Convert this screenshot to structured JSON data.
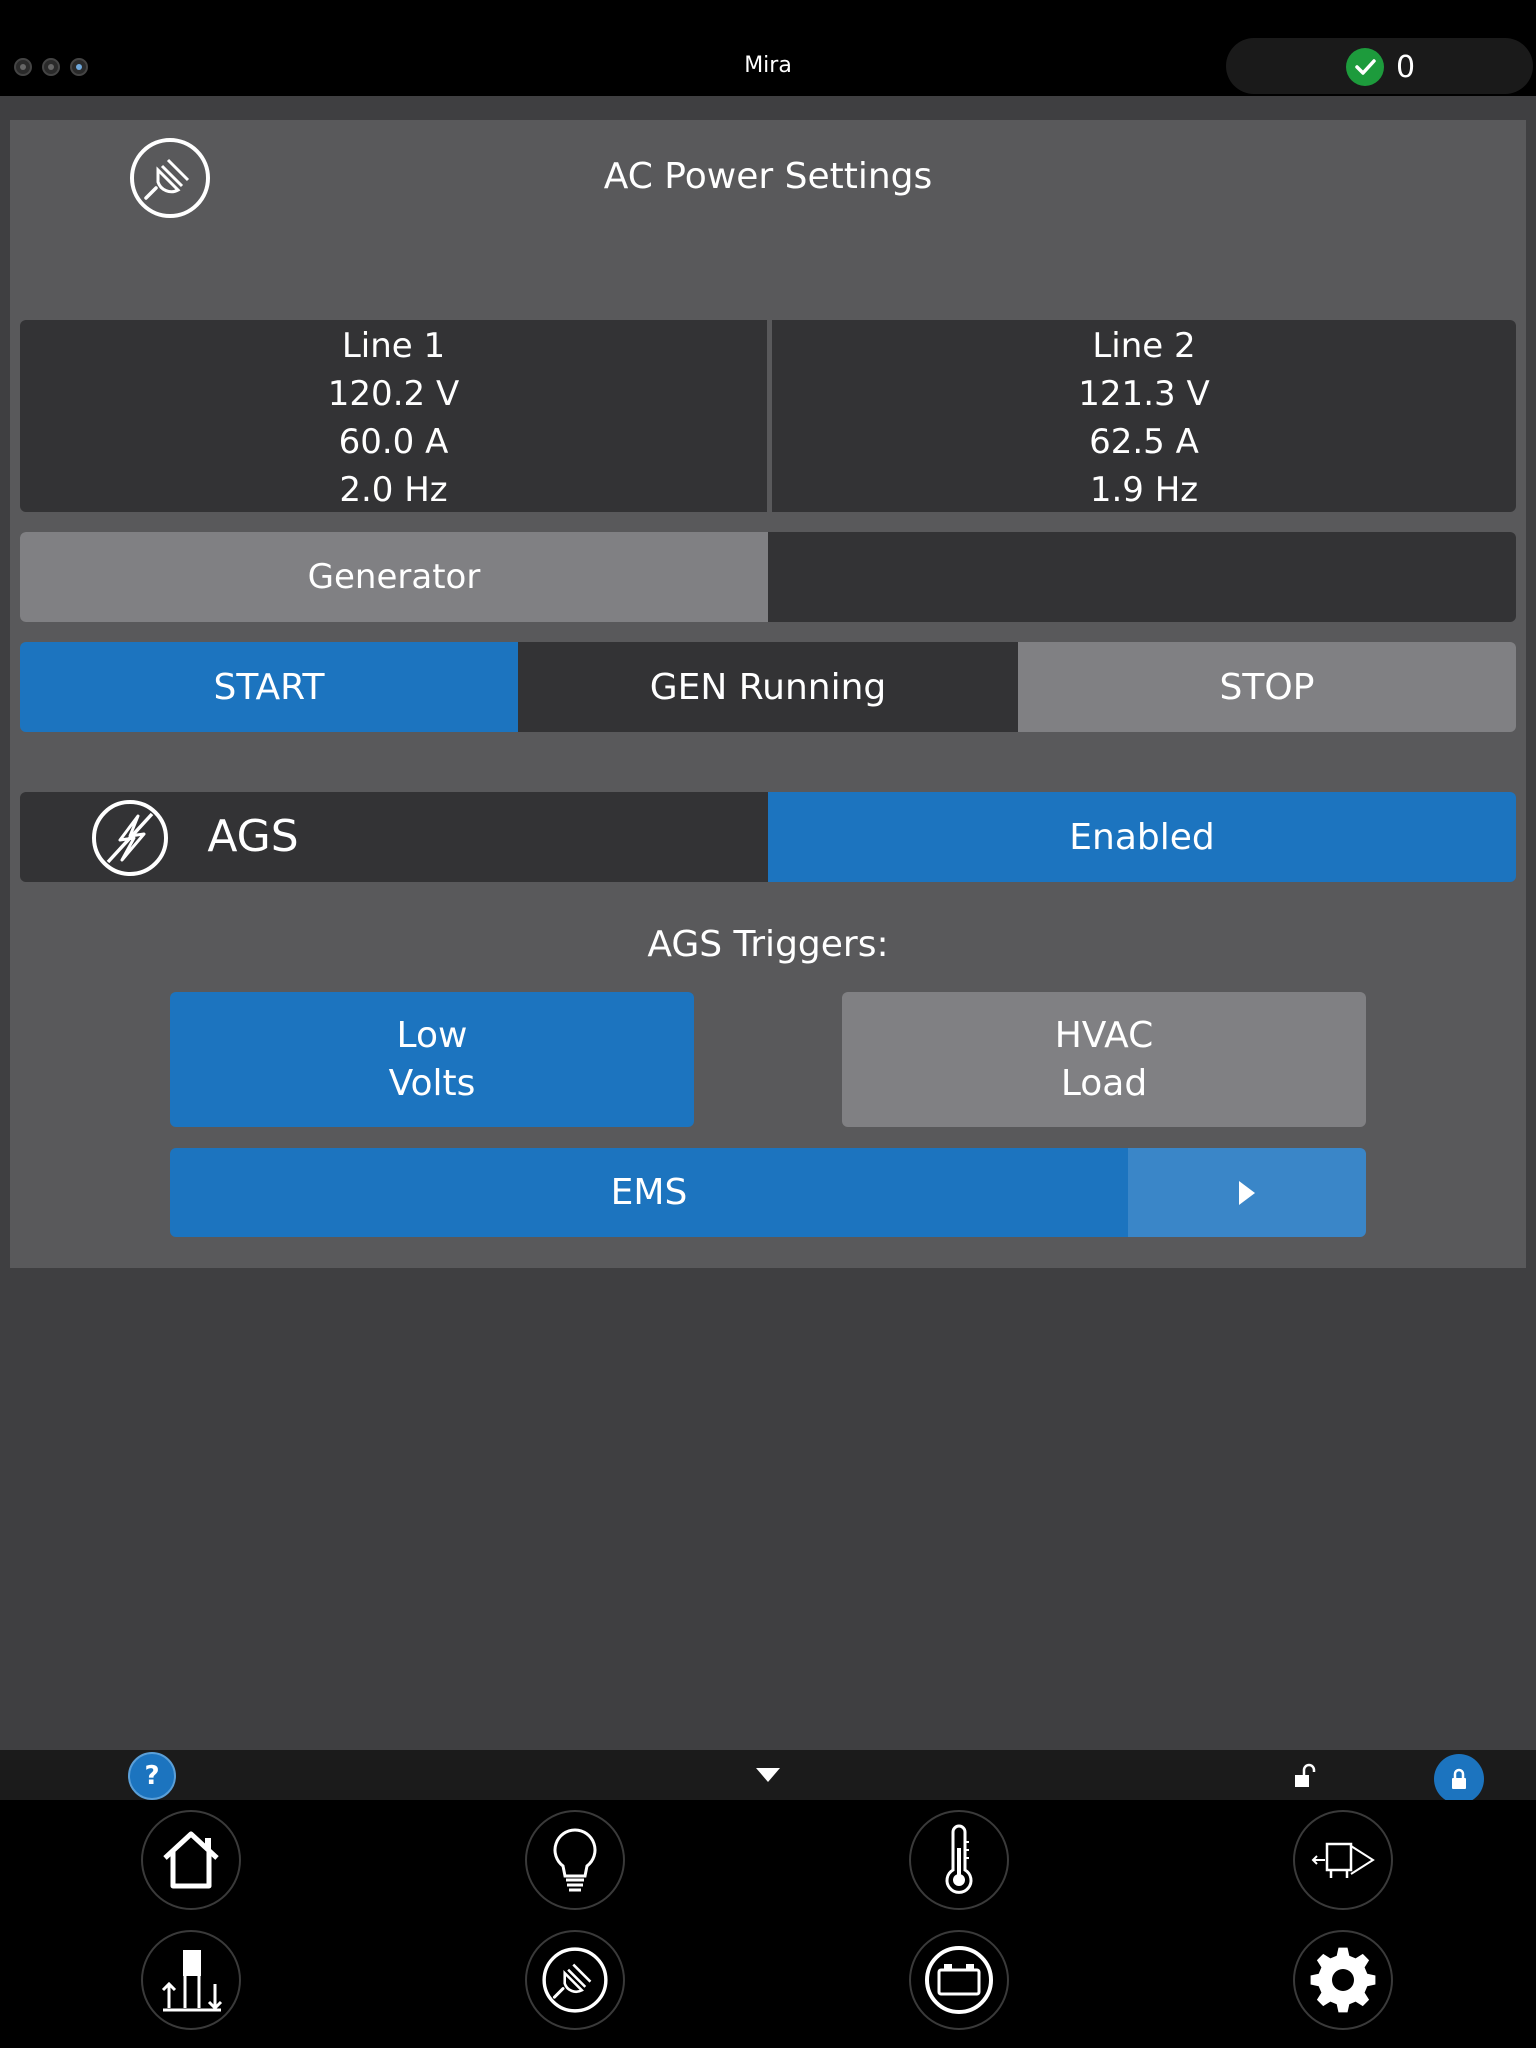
{
  "topbar": {
    "title": "Mira",
    "status_count": "0",
    "status_icon": "check-icon",
    "status_color": "#1d9b3c"
  },
  "panel": {
    "title": "AC Power Settings",
    "icon": "plug-icon",
    "lines": [
      {
        "name": "Line 1",
        "voltage": "120.2 V",
        "current": "60.0 A",
        "frequency": "2.0 Hz"
      },
      {
        "name": "Line 2",
        "voltage": "121.3 V",
        "current": "62.5 A",
        "frequency": "1.9 Hz"
      }
    ],
    "generator_label": "Generator",
    "controls": {
      "start_label": "START",
      "status_label": "GEN Running",
      "stop_label": "STOP"
    },
    "ags": {
      "label": "AGS",
      "state": "Enabled",
      "icon": "lightning-icon"
    },
    "triggers": {
      "title": "AGS Triggers:",
      "low_volts": [
        "Low",
        "Volts"
      ],
      "hvac_load": [
        "HVAC",
        "Load"
      ],
      "ems_label": "EMS"
    }
  },
  "bottom": {
    "help_label": "?",
    "nav": [
      "home-icon",
      "lightbulb-icon",
      "thermometer-icon",
      "slide-out-icon",
      "leveling-icon",
      "plug-icon",
      "battery-icon",
      "gear-icon"
    ]
  },
  "colors": {
    "accent": "#1c74bf",
    "panel": "#59595b",
    "dark_cell": "#333335",
    "inactive_button": "#808083"
  }
}
